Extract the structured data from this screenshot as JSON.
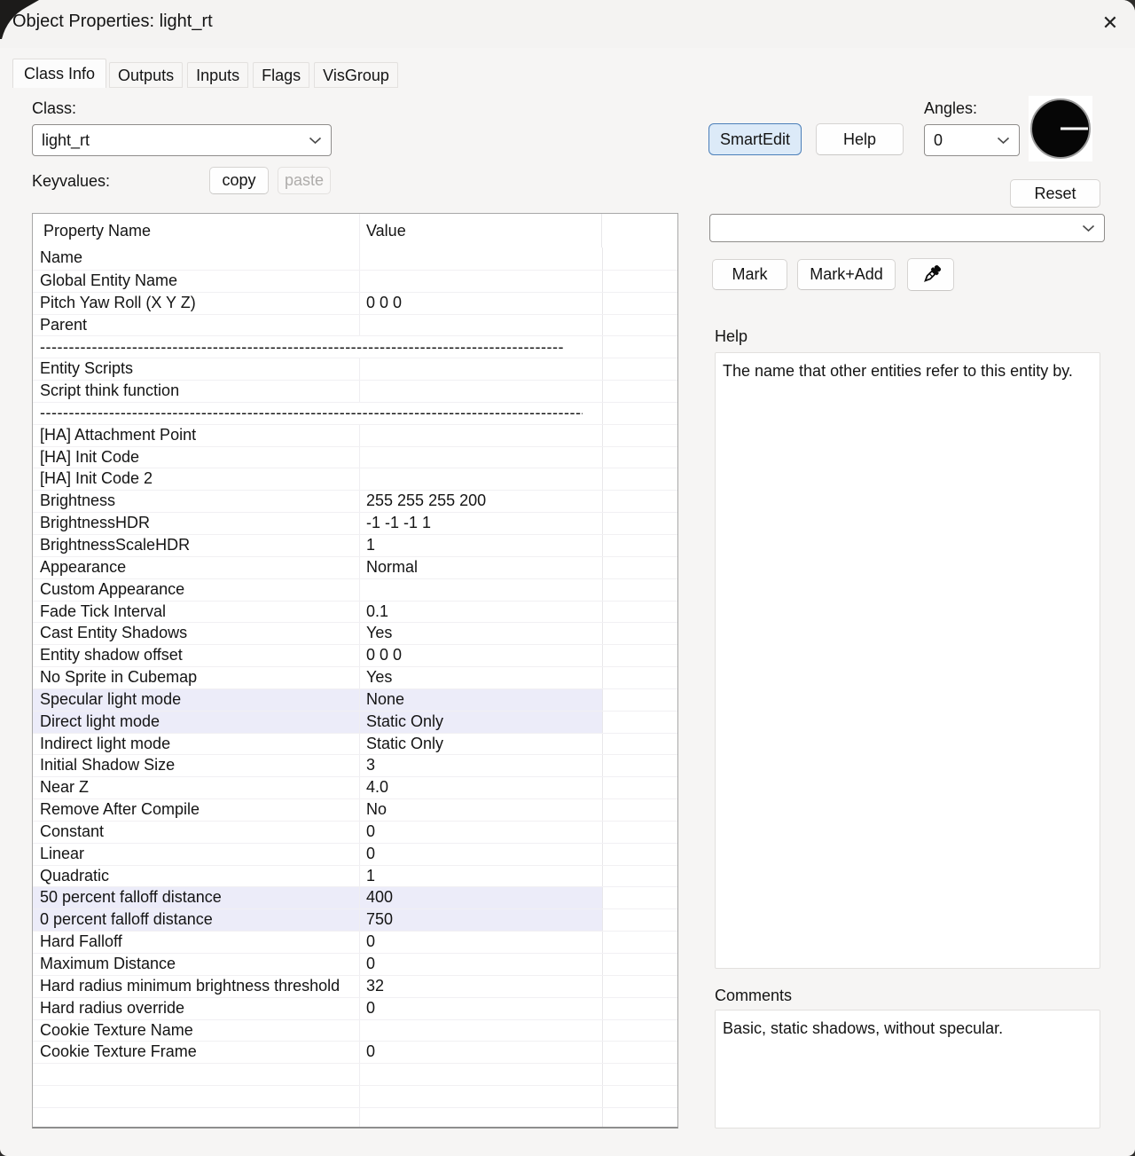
{
  "window": {
    "title": "Object Properties: light_rt",
    "close_glyph": "✕"
  },
  "tabs": [
    {
      "label": "Class Info",
      "active": true
    },
    {
      "label": "Outputs",
      "active": false
    },
    {
      "label": "Inputs",
      "active": false
    },
    {
      "label": "Flags",
      "active": false
    },
    {
      "label": "VisGroup",
      "active": false
    }
  ],
  "class_section": {
    "label": "Class:",
    "value": "light_rt",
    "keyvalues_label": "Keyvalues:",
    "copy_label": "copy",
    "paste_label": "paste"
  },
  "toolbar": {
    "smartedit_label": "SmartEdit",
    "help_label": "Help",
    "reset_label": "Reset",
    "mark_label": "Mark",
    "mark_add_label": "Mark+Add",
    "eyedropper_icon": "eyedropper-icon"
  },
  "angles": {
    "label": "Angles:",
    "value": "0",
    "dial_angle_deg": 0
  },
  "smartedit_picker": {
    "value": ""
  },
  "help_section": {
    "label": "Help",
    "text": "The name that other entities refer to this entity by."
  },
  "comments_section": {
    "label": "Comments",
    "text": "Basic, static shadows, without specular."
  },
  "table": {
    "headers": {
      "name": "Property Name",
      "value": "Value"
    },
    "separator_dashes": "--------------------------------------------------------------------------------------------------------------",
    "empty_row_count": 3,
    "rows": [
      {
        "name": "Name",
        "value": ""
      },
      {
        "name": "Global Entity Name",
        "value": ""
      },
      {
        "name": "Pitch Yaw Roll (X Y Z)",
        "value": "0 0 0"
      },
      {
        "name": "Parent",
        "value": ""
      },
      {
        "separator": true,
        "clip": 599
      },
      {
        "name": "Entity Scripts",
        "value": ""
      },
      {
        "name": "Script think function",
        "value": ""
      },
      {
        "separator": true,
        "clip": 620
      },
      {
        "name": "[HA] Attachment Point",
        "value": ""
      },
      {
        "name": "[HA] Init Code",
        "value": ""
      },
      {
        "name": "[HA] Init Code 2",
        "value": ""
      },
      {
        "name": "Brightness",
        "value": "255 255 255 200"
      },
      {
        "name": "BrightnessHDR",
        "value": "-1 -1 -1 1"
      },
      {
        "name": "BrightnessScaleHDR",
        "value": "1"
      },
      {
        "name": "Appearance",
        "value": "Normal"
      },
      {
        "name": "Custom Appearance",
        "value": ""
      },
      {
        "name": "Fade Tick Interval",
        "value": "0.1"
      },
      {
        "name": "Cast Entity Shadows",
        "value": "Yes"
      },
      {
        "name": "Entity shadow offset",
        "value": "0 0 0"
      },
      {
        "name": "No Sprite in Cubemap",
        "value": "Yes"
      },
      {
        "name": "Specular light mode",
        "value": "None",
        "highlight": true
      },
      {
        "name": "Direct light mode",
        "value": "Static Only",
        "highlight": true
      },
      {
        "name": "Indirect light mode",
        "value": "Static Only"
      },
      {
        "name": "Initial Shadow Size",
        "value": "3"
      },
      {
        "name": "Near Z",
        "value": "4.0"
      },
      {
        "name": "Remove After Compile",
        "value": "No"
      },
      {
        "name": "Constant",
        "value": "0"
      },
      {
        "name": "Linear",
        "value": "0"
      },
      {
        "name": "Quadratic",
        "value": "1"
      },
      {
        "name": "50 percent falloff distance",
        "value": "400",
        "highlight": true
      },
      {
        "name": "0 percent falloff distance",
        "value": "750",
        "highlight": true
      },
      {
        "name": "Hard Falloff",
        "value": "0"
      },
      {
        "name": "Maximum Distance",
        "value": "0"
      },
      {
        "name": "Hard radius minimum brightness threshold",
        "value": "32"
      },
      {
        "name": "Hard radius override",
        "value": "0"
      },
      {
        "name": "Cookie Texture Name",
        "value": ""
      },
      {
        "name": "Cookie Texture Frame",
        "value": "0"
      }
    ]
  },
  "colors": {
    "row_highlight": "#ececf9",
    "smartedit_bg": "#dceaf8",
    "smartedit_border": "#4b7fb9",
    "dial_fill": "#060606",
    "window_bg": "#f6f5f4"
  }
}
